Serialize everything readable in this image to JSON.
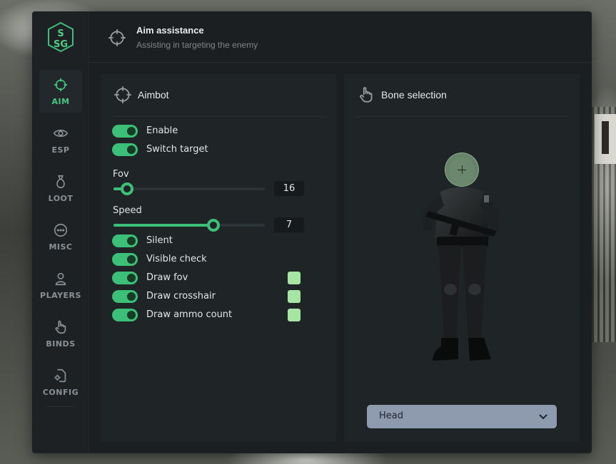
{
  "brand": {
    "logo_text_top": "S",
    "logo_text_bottom": "SG"
  },
  "sidebar": {
    "items": [
      {
        "label": "AIM",
        "icon": "crosshair-icon",
        "active": true
      },
      {
        "label": "ESP",
        "icon": "eye-icon"
      },
      {
        "label": "LOOT",
        "icon": "loot-bag-icon"
      },
      {
        "label": "MISC",
        "icon": "more-dots-icon"
      },
      {
        "label": "PLAYERS",
        "icon": "user-icon"
      },
      {
        "label": "BINDS",
        "icon": "pointer-hand-icon"
      },
      {
        "label": "CONFIG",
        "icon": "config-file-icon"
      }
    ]
  },
  "header": {
    "title": "Aim assistance",
    "subtitle": "Assisting in targeting the enemy",
    "icon": "crosshair-icon"
  },
  "aimbot": {
    "title": "Aimbot",
    "enable_label": "Enable",
    "switch_target_label": "Switch target",
    "fov": {
      "label": "Fov",
      "value": "16",
      "fraction": 0.09
    },
    "speed": {
      "label": "Speed",
      "value": "7",
      "fraction": 0.66
    },
    "silent_label": "Silent",
    "visible_check_label": "Visible check",
    "draw_fov_label": "Draw fov",
    "draw_crosshair_label": "Draw crosshair",
    "draw_ammo_label": "Draw ammo count"
  },
  "bone": {
    "title": "Bone selection",
    "selected": "Head",
    "icon": "pointer-hand-icon"
  },
  "colors": {
    "accent": "#3cbf76",
    "swatch": "#a6e6a2",
    "panel": "#1f2427",
    "window": "#1b1f21"
  }
}
